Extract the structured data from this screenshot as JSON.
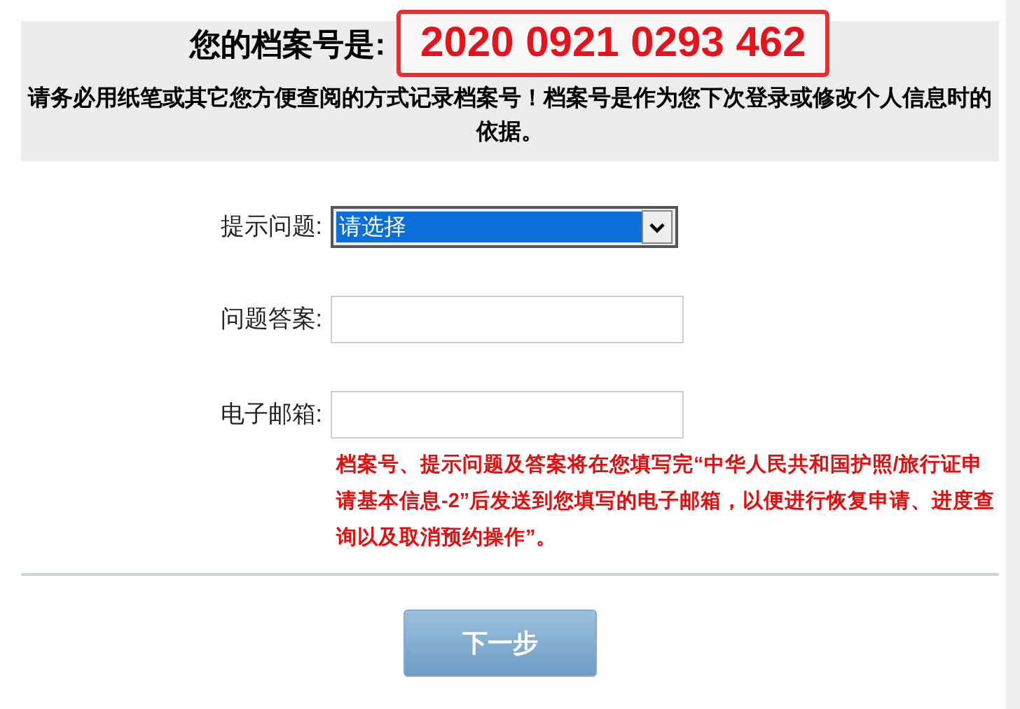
{
  "header": {
    "title": "您的档案号是:",
    "archive_number": "2020 0921 0293 462",
    "notice": "请务必用纸笔或其它您方便查阅的方式记录档案号！档案号是作为您下次登录或修改个人信息时的依据。"
  },
  "form": {
    "fields": [
      {
        "kind": "select",
        "label": "提示问题:",
        "value": "请选择"
      },
      {
        "kind": "text",
        "label": "问题答案:"
      },
      {
        "kind": "text",
        "label": "电子邮箱:"
      }
    ],
    "note": "档案号、提示问题及答案将在您填写完“中华人民共和国护照/旅行证申请基本信息-2”后发送到您填写的电子邮箱，以便进行恢复申请、进度查询以及取消预约操作”。"
  },
  "buttons": [
    {
      "label": "下一步"
    }
  ]
}
